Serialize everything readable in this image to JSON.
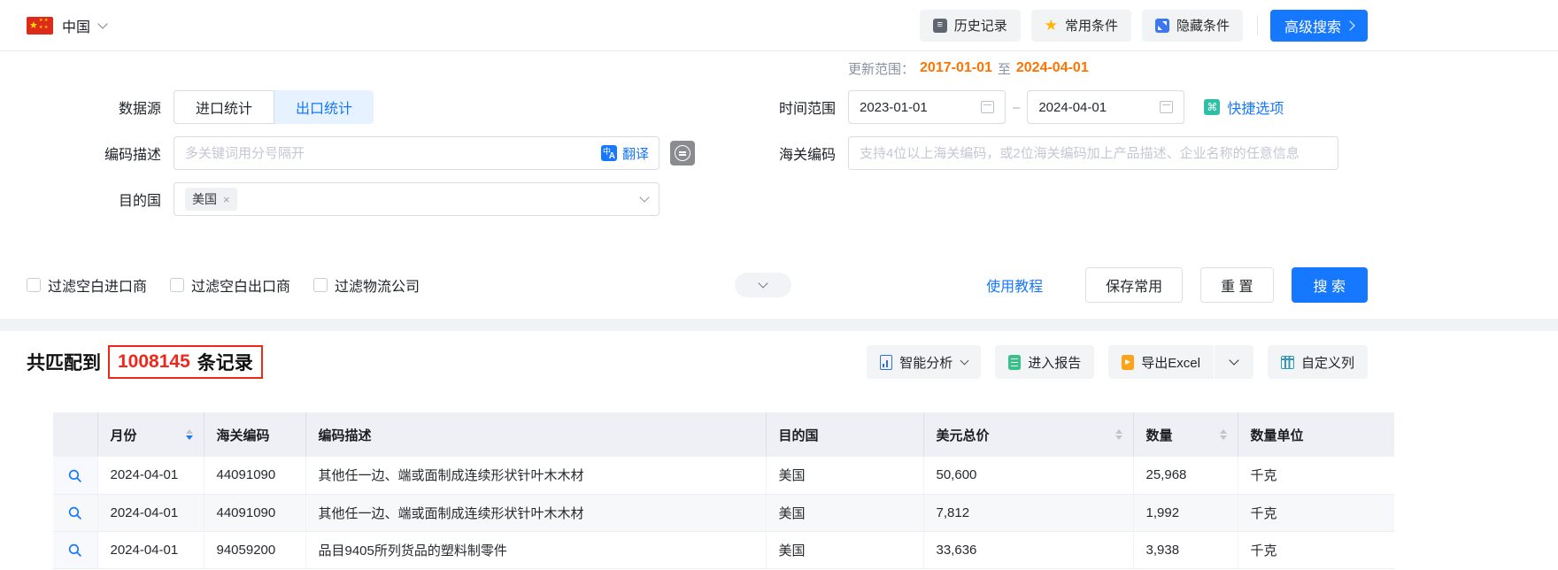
{
  "header": {
    "country": "中国",
    "history_label": "历史记录",
    "favorites_label": "常用条件",
    "hide_label": "隐藏条件",
    "advanced_label": "高级搜索"
  },
  "form": {
    "update_range": {
      "label": "更新范围：",
      "start": "2017-01-01",
      "to_word": "至",
      "end": "2024-04-01"
    },
    "data_source": {
      "label": "数据源",
      "import_tab": "进口统计",
      "export_tab": "出口统计"
    },
    "time_range": {
      "label": "时间范围",
      "start": "2023-01-01",
      "end": "2024-04-01",
      "quick_label": "快捷选项"
    },
    "code_desc": {
      "label": "编码描述",
      "placeholder": "多关键词用分号隔开",
      "translate_label": "翻译"
    },
    "hs_code": {
      "label": "海关编码",
      "placeholder": "支持4位以上海关编码，或2位海关编码加上产品描述、企业名称的任意信息"
    },
    "destination": {
      "label": "目的国",
      "tag": "美国",
      "tag_close": "×"
    },
    "checkboxes": [
      {
        "label": "过滤空白进口商",
        "checked": false
      },
      {
        "label": "过滤空白出口商",
        "checked": false
      },
      {
        "label": "过滤物流公司",
        "checked": false
      }
    ],
    "tutorial_label": "使用教程",
    "save_label": "保存常用",
    "reset_label": "重 置",
    "search_label": "搜 索"
  },
  "results": {
    "prefix": "共匹配到",
    "count": "1008145",
    "suffix": "条记录",
    "actions": {
      "analysis": "智能分析",
      "report": "进入报告",
      "export": "导出Excel",
      "columns": "自定义列"
    }
  },
  "table": {
    "headers": [
      "月份",
      "海关编码",
      "编码描述",
      "目的国",
      "美元总价",
      "数量",
      "数量单位"
    ],
    "sort": {
      "month": "desc",
      "usd_total": "none",
      "quantity": "none"
    },
    "rows": [
      [
        "2024-04-01",
        "44091090",
        "其他任一边、端或面制成连续形状针叶木木材",
        "美国",
        "50,600",
        "25,968",
        "千克"
      ],
      [
        "2024-04-01",
        "44091090",
        "其他任一边、端或面制成连续形状针叶木木材",
        "美国",
        "7,812",
        "1,992",
        "千克"
      ],
      [
        "2024-04-01",
        "94059200",
        "品目9405所列货品的塑料制零件",
        "美国",
        "33,636",
        "3,938",
        "千克"
      ]
    ]
  },
  "icons": {
    "flag-icon": "china-flag",
    "history-icon": "document-lines",
    "favorites-icon": "star",
    "hide-icon": "collapse-arrows",
    "calendar-icon": "calendar",
    "quick-options-icon": "command-key",
    "translate-icon": "中A",
    "filter-circle-icon": "circled-lines",
    "analysis-icon": "bi-chart-doc",
    "report-icon": "green-notebook",
    "export-icon": "orange-doc-arrow",
    "columns-icon": "table-columns",
    "row-detail-icon": "magnifier"
  },
  "colors": {
    "accent_blue": "#1677ff",
    "date_orange": "#ff7300",
    "count_red": "#f2271c",
    "quick_teal": "#2fbfa4"
  }
}
